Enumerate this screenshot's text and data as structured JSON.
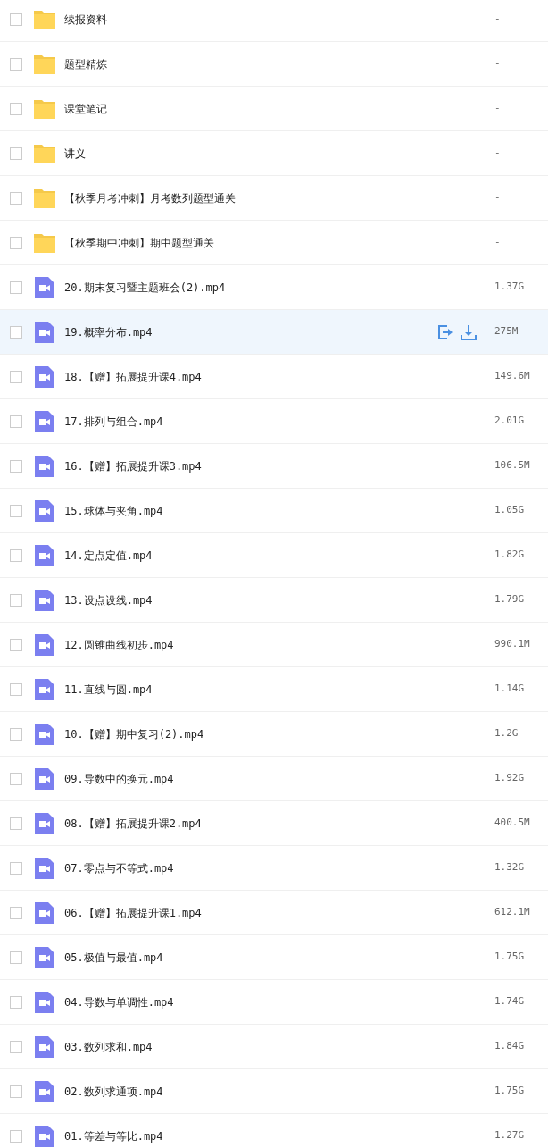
{
  "files": [
    {
      "kind": "folder",
      "name": "续报资料",
      "size": "-",
      "checked": false,
      "highlighted": false
    },
    {
      "kind": "folder",
      "name": "题型精炼",
      "size": "-",
      "checked": false,
      "highlighted": false
    },
    {
      "kind": "folder",
      "name": "课堂笔记",
      "size": "-",
      "checked": false,
      "highlighted": false
    },
    {
      "kind": "folder",
      "name": "讲义",
      "size": "-",
      "checked": false,
      "highlighted": false
    },
    {
      "kind": "folder",
      "name": "【秋季月考冲刺】月考数列题型通关",
      "size": "-",
      "checked": false,
      "highlighted": false
    },
    {
      "kind": "folder",
      "name": "【秋季期中冲刺】期中题型通关",
      "size": "-",
      "checked": false,
      "highlighted": false
    },
    {
      "kind": "video",
      "name": "20.期末复习暨主题班会(2).mp4",
      "size": "1.37G",
      "checked": false,
      "highlighted": false
    },
    {
      "kind": "video",
      "name": "19.概率分布.mp4",
      "size": "275M",
      "checked": false,
      "highlighted": true
    },
    {
      "kind": "video",
      "name": "18.【赠】拓展提升课4.mp4",
      "size": "149.6M",
      "checked": false,
      "highlighted": false
    },
    {
      "kind": "video",
      "name": "17.排列与组合.mp4",
      "size": "2.01G",
      "checked": false,
      "highlighted": false
    },
    {
      "kind": "video",
      "name": "16.【赠】拓展提升课3.mp4",
      "size": "106.5M",
      "checked": false,
      "highlighted": false
    },
    {
      "kind": "video",
      "name": "15.球体与夹角.mp4",
      "size": "1.05G",
      "checked": false,
      "highlighted": false
    },
    {
      "kind": "video",
      "name": "14.定点定值.mp4",
      "size": "1.82G",
      "checked": false,
      "highlighted": false
    },
    {
      "kind": "video",
      "name": "13.设点设线.mp4",
      "size": "1.79G",
      "checked": false,
      "highlighted": false
    },
    {
      "kind": "video",
      "name": "12.圆锥曲线初步.mp4",
      "size": "990.1M",
      "checked": false,
      "highlighted": false
    },
    {
      "kind": "video",
      "name": "11.直线与圆.mp4",
      "size": "1.14G",
      "checked": false,
      "highlighted": false
    },
    {
      "kind": "video",
      "name": "10.【赠】期中复习(2).mp4",
      "size": "1.2G",
      "checked": false,
      "highlighted": false
    },
    {
      "kind": "video",
      "name": "09.导数中的换元.mp4",
      "size": "1.92G",
      "checked": false,
      "highlighted": false
    },
    {
      "kind": "video",
      "name": "08.【赠】拓展提升课2.mp4",
      "size": "400.5M",
      "checked": false,
      "highlighted": false
    },
    {
      "kind": "video",
      "name": "07.零点与不等式.mp4",
      "size": "1.32G",
      "checked": false,
      "highlighted": false
    },
    {
      "kind": "video",
      "name": "06.【赠】拓展提升课1.mp4",
      "size": "612.1M",
      "checked": false,
      "highlighted": false
    },
    {
      "kind": "video",
      "name": "05.极值与最值.mp4",
      "size": "1.75G",
      "checked": false,
      "highlighted": false
    },
    {
      "kind": "video",
      "name": "04.导数与单调性.mp4",
      "size": "1.74G",
      "checked": false,
      "highlighted": false
    },
    {
      "kind": "video",
      "name": "03.数列求和.mp4",
      "size": "1.84G",
      "checked": false,
      "highlighted": false
    },
    {
      "kind": "video",
      "name": "02.数列求通项.mp4",
      "size": "1.75G",
      "checked": false,
      "highlighted": false
    },
    {
      "kind": "video",
      "name": "01.等差与等比.mp4",
      "size": "1.27G",
      "checked": false,
      "highlighted": false
    }
  ]
}
